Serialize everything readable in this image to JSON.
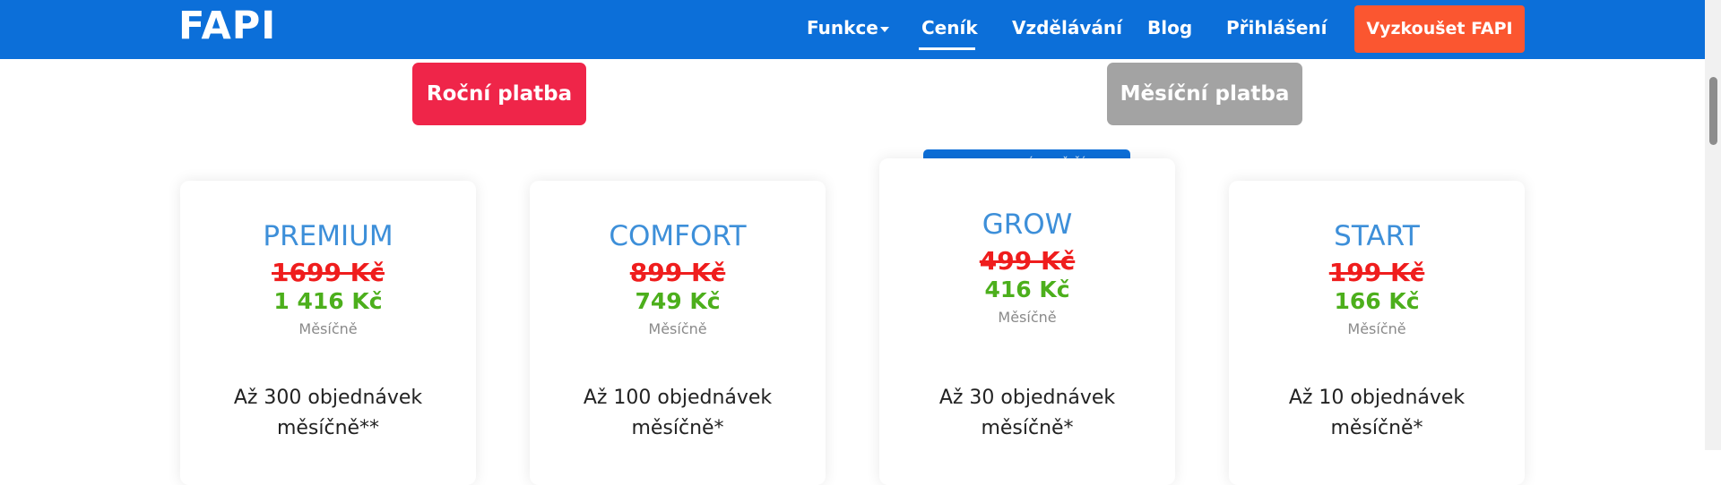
{
  "header": {
    "logo": "FAPI",
    "nav": {
      "funkce": "Funkce",
      "cenik": "Ceník",
      "vzdelavani": "Vzdělávání",
      "blog": "Blog",
      "prihlaseni": "Přihlášení"
    },
    "cta": "Vyzkoušet FAPI",
    "colors": {
      "background": "#0c6fd9",
      "cta": "#fb5630"
    }
  },
  "billing_toggle": {
    "yearly": "Roční platba",
    "monthly": "Měsíční platba",
    "active": "yearly",
    "colors": {
      "active": "#ef2549",
      "inactive": "#a3a3a3"
    }
  },
  "badge": "NEJPRODÁVANĚJŠÍ",
  "plans": [
    {
      "name": "PREMIUM",
      "old_price": "1699 Kč",
      "new_price": "1 416 Kč",
      "period": "Měsíčně",
      "feature_line1": "Až 300 objednávek",
      "feature_line2": "měsíčně**"
    },
    {
      "name": "COMFORT",
      "old_price": "899 Kč",
      "new_price": "749 Kč",
      "period": "Měsíčně",
      "feature_line1": "Až 100 objednávek",
      "feature_line2": "měsíčně*"
    },
    {
      "name": "GROW",
      "old_price": "499 Kč",
      "new_price": "416 Kč",
      "period": "Měsíčně",
      "feature_line1": "Až 30 objednávek",
      "feature_line2": "měsíčně*"
    },
    {
      "name": "START",
      "old_price": "199 Kč",
      "new_price": "166 Kč",
      "period": "Měsíčně",
      "feature_line1": "Až 10 objednávek",
      "feature_line2": "měsíčně*"
    }
  ]
}
